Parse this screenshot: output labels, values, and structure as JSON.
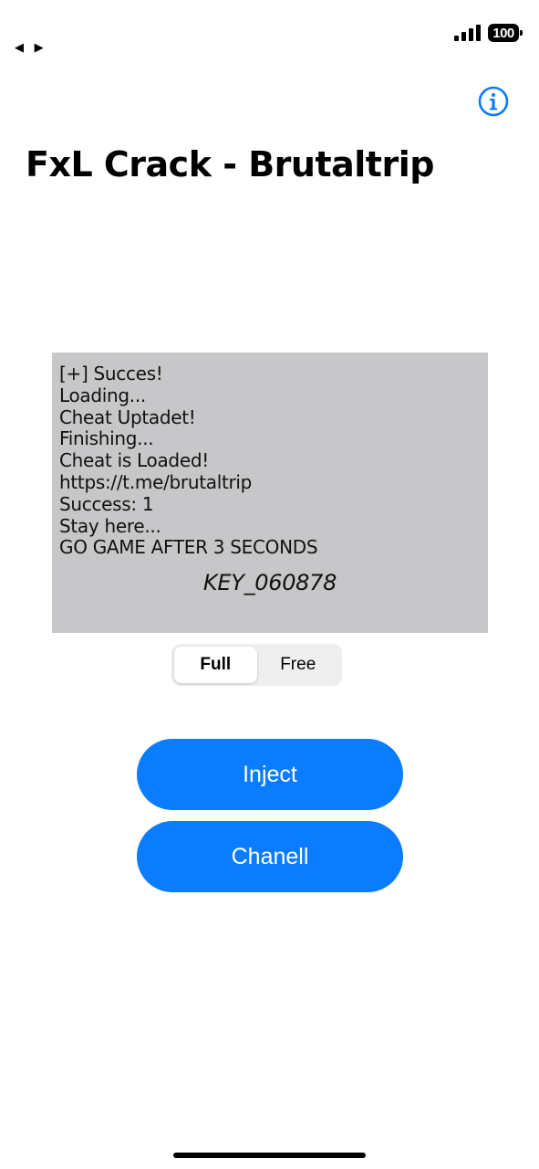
{
  "status_bar": {
    "battery": "100"
  },
  "nav": {
    "arrows": "◀ ▶"
  },
  "header": {
    "title": "FxL Crack - Brutaltrip",
    "info_icon": "info-circle-icon"
  },
  "log": {
    "lines": [
      "[+] Succes!",
      "Loading...",
      "Cheat Uptadet!",
      "Finishing...",
      "Cheat is Loaded!",
      "https://t.me/brutaltrip",
      "Success: 1",
      "Stay here...",
      "GO GAME AFTER 3 SECONDS"
    ],
    "key": "KEY_060878"
  },
  "mode": {
    "options": [
      "Full",
      "Free"
    ],
    "selected": "Full"
  },
  "actions": {
    "inject_label": "Inject",
    "channel_label": "Chanell"
  },
  "colors": {
    "accent": "#0a7cff",
    "log_background": "#c7c7c9"
  }
}
